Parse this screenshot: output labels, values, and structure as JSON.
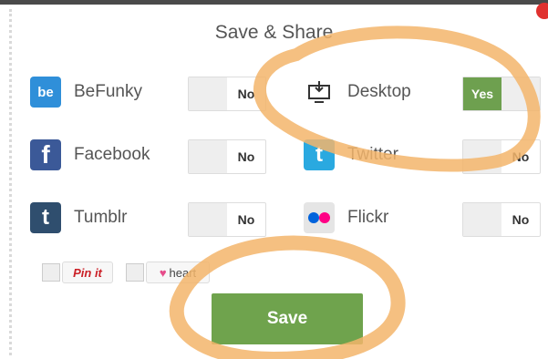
{
  "dialog": {
    "title": "Save & Share"
  },
  "services": [
    {
      "name": "BeFunky",
      "state": "No",
      "icon": "befunky-icon",
      "icon_color": "#2f8fd9"
    },
    {
      "name": "Desktop",
      "state": "Yes",
      "icon": "desktop-icon",
      "icon_color": "#333333"
    },
    {
      "name": "Facebook",
      "state": "No",
      "icon": "facebook-icon",
      "icon_color": "#3b5998"
    },
    {
      "name": "Twitter",
      "state": "No",
      "icon": "twitter-icon",
      "icon_color": "#2aa9e0"
    },
    {
      "name": "Tumblr",
      "state": "No",
      "icon": "tumblr-icon",
      "icon_color": "#2f4e6e"
    },
    {
      "name": "Flickr",
      "state": "No",
      "icon": "flickr-icon",
      "icon_color": "#e5e5e5"
    }
  ],
  "social_buttons": {
    "pinterest_label": "Pin it",
    "heart_label": "heart"
  },
  "actions": {
    "save_label": "Save"
  },
  "colors": {
    "accent_green": "#6fa34d",
    "annotation_orange": "#f3b56b"
  }
}
